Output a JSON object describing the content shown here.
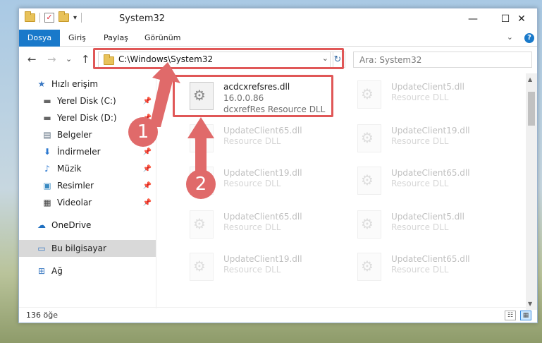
{
  "window": {
    "title": "System32",
    "qat_dropdown": "▾",
    "minimize": "—",
    "maximize": "☐",
    "close": "✕"
  },
  "ribbon": {
    "tabs": [
      "Dosya",
      "Giriş",
      "Paylaş",
      "Görünüm"
    ],
    "collapse": "⌄",
    "help": "?"
  },
  "nav": {
    "back": "←",
    "forward": "→",
    "recent": "⌄",
    "up": "↑",
    "address": "C:\\Windows\\System32",
    "address_dropdown": "⌄",
    "refresh": "↻",
    "search_placeholder": "Ara: System32"
  },
  "sidebar": {
    "items": [
      {
        "label": "Hızlı erişim",
        "icon": "star-icon",
        "glyph": "★",
        "color": "#3a78c2",
        "pinned": false
      },
      {
        "label": "Yerel Disk (C:)",
        "icon": "drive-icon",
        "glyph": "▬",
        "color": "#666666",
        "pinned": true
      },
      {
        "label": "Yerel Disk (D:)",
        "icon": "drive-icon",
        "glyph": "▬",
        "color": "#666666",
        "pinned": true
      },
      {
        "label": "Belgeler",
        "icon": "documents-icon",
        "glyph": "▤",
        "color": "#5a6b7c",
        "pinned": true
      },
      {
        "label": "İndirmeler",
        "icon": "download-icon",
        "glyph": "⬇",
        "color": "#2b78d0",
        "pinned": true
      },
      {
        "label": "Müzik",
        "icon": "music-icon",
        "glyph": "♪",
        "color": "#2b78d0",
        "pinned": true
      },
      {
        "label": "Resimler",
        "icon": "pictures-icon",
        "glyph": "▣",
        "color": "#3a8ac2",
        "pinned": true
      },
      {
        "label": "Videolar",
        "icon": "video-icon",
        "glyph": "▦",
        "color": "#444444",
        "pinned": true
      },
      {
        "label": "OneDrive",
        "icon": "cloud-icon",
        "glyph": "☁",
        "color": "#1e6fc0",
        "pinned": false
      },
      {
        "label": "Bu bilgisayar",
        "icon": "computer-icon",
        "glyph": "▭",
        "color": "#3a78c2",
        "pinned": false
      },
      {
        "label": "Ağ",
        "icon": "network-icon",
        "glyph": "⊞",
        "color": "#3a78c2",
        "pinned": false
      }
    ],
    "pin_glyph": "📌"
  },
  "files": [
    {
      "name": "acdcxrefsres.dll",
      "version": "16.0.0.86",
      "desc": "dcxrefRes Resource DLL",
      "faded": false
    },
    {
      "name": "UpdateClient5.dll",
      "desc": "Resource DLL",
      "faded": true
    },
    {
      "name": "UpdateClient65.dll",
      "desc": "Resource DLL",
      "faded": true
    },
    {
      "name": "UpdateClient19.dll",
      "desc": "Resource DLL",
      "faded": true
    },
    {
      "name": "UpdateClient19.dll",
      "desc": "Resource DLL",
      "faded": true
    },
    {
      "name": "UpdateClient65.dll",
      "desc": "Resource DLL",
      "faded": true
    },
    {
      "name": "UpdateClient65.dll",
      "desc": "Resource DLL",
      "faded": true
    },
    {
      "name": "UpdateClient5.dll",
      "desc": "Resource DLL",
      "faded": true
    },
    {
      "name": "UpdateClient19.dll",
      "desc": "Resource DLL",
      "faded": true
    },
    {
      "name": "UpdateClient65.dll",
      "desc": "Resource DLL",
      "faded": true
    }
  ],
  "status": {
    "count": "136 öğe",
    "details_view": "☷",
    "tiles_view": "▦"
  },
  "annotations": {
    "step1": "1",
    "step2": "2",
    "color": "#e05757"
  }
}
